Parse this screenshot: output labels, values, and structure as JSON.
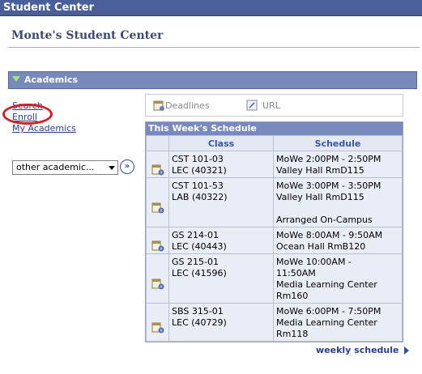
{
  "header": {
    "title": "Student Center"
  },
  "page": {
    "title": "Monte's Student Center"
  },
  "section": {
    "title": "Academics"
  },
  "left_links": [
    "Search",
    "Enroll",
    "My Academics"
  ],
  "dropdown": {
    "selected": "other academic..."
  },
  "tabs": {
    "deadlines": "Deadlines",
    "url": "URL"
  },
  "schedule": {
    "title": "This Week's Schedule",
    "columns": [
      "Class",
      "Schedule"
    ],
    "rows": [
      {
        "class": "CST 101-03\nLEC (40321)",
        "schedule": "MoWe 2:00PM - 2:50PM\nValley Hall RmD115"
      },
      {
        "class": "CST 101-53\nLAB (40322)",
        "schedule": "MoWe 3:00PM - 3:50PM\nValley Hall RmD115\n\nArranged On-Campus"
      },
      {
        "class": "GS 214-01\nLEC (40443)",
        "schedule": "MoWe 8:00AM - 9:50AM\nOcean Hall RmB120"
      },
      {
        "class": "GS 215-01\nLEC (41596)",
        "schedule": "MoWe 10:00AM -\n11:50AM\nMedia Learning Center\nRm160"
      },
      {
        "class": "SBS 315-01\nLEC (40729)",
        "schedule": "MoWe 6:00PM - 7:50PM\nMedia Learning Center\nRm118"
      }
    ]
  },
  "footer_link": "weekly schedule",
  "icons": {
    "row": "calendar-info-icon",
    "deadlines": "calendar-icon",
    "url": "link-icon",
    "go": "double-chevron-right-icon"
  },
  "colors": {
    "topbar": "#4a5f99",
    "section": "#7889bb",
    "annotation": "#d21f24",
    "link": "#2a3f8f"
  }
}
